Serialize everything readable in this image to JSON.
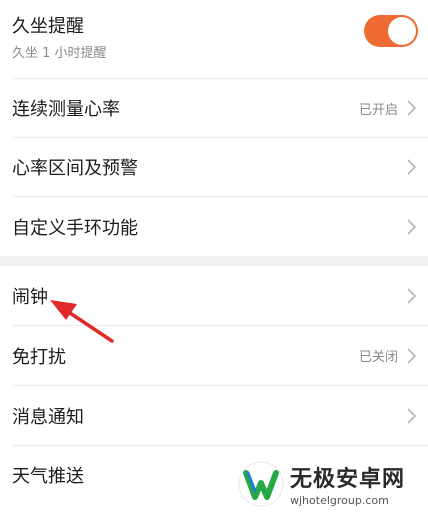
{
  "settings": {
    "sedentary": {
      "title": "久坐提醒",
      "subtitle": "久坐 1 小时提醒",
      "enabled": true
    },
    "group1": [
      {
        "label": "连续测量心率",
        "value": "已开启"
      },
      {
        "label": "心率区间及预警",
        "value": ""
      },
      {
        "label": "自定义手环功能",
        "value": ""
      }
    ],
    "group2": [
      {
        "label": "闹钟",
        "value": ""
      },
      {
        "label": "免打扰",
        "value": "已关闭"
      },
      {
        "label": "消息通知",
        "value": ""
      },
      {
        "label": "天气推送",
        "value": ""
      }
    ]
  },
  "colors": {
    "toggle_on": "#ee6c33",
    "annotation_arrow": "#e02a2a"
  },
  "watermark": {
    "name": "无极安卓网",
    "url": "wjhotelgroup.com"
  }
}
